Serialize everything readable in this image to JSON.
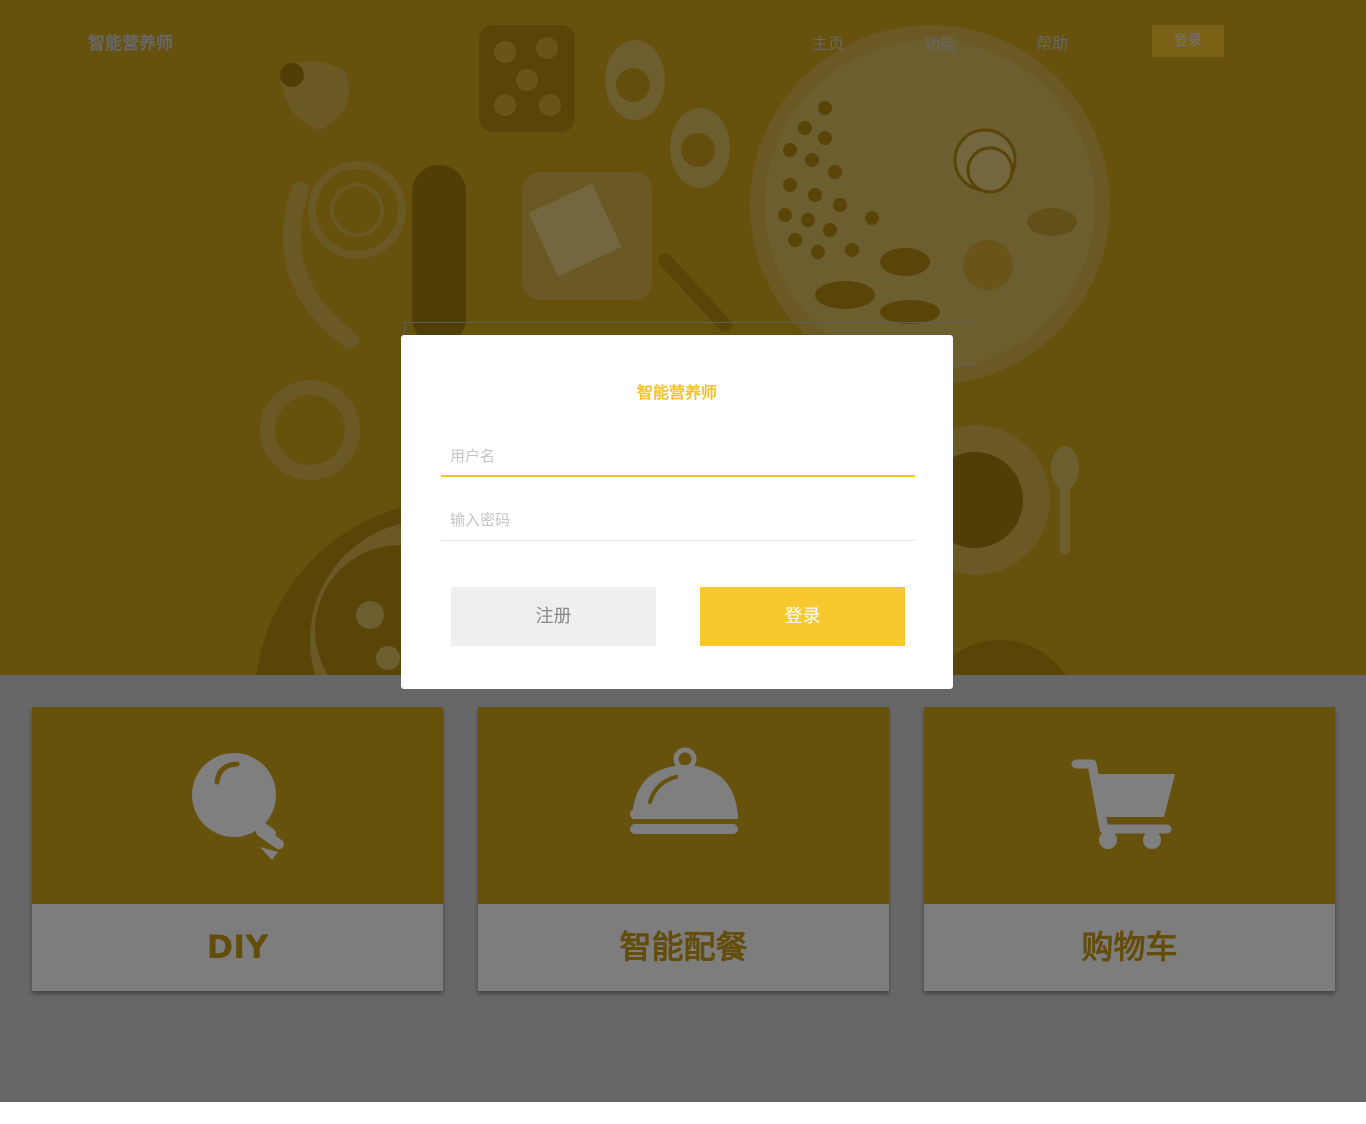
{
  "nav": {
    "logo": "智能营养师",
    "links": [
      "主页",
      "功能",
      "帮助"
    ],
    "login": "登录"
  },
  "colors": {
    "accent": "#f7c22a",
    "hero": "#cca21a",
    "panel": "#fafafa",
    "overlay": "rgba(0,0,0,0.5)"
  },
  "features": [
    {
      "label": "DIY",
      "icon": "lightbulb-icon"
    },
    {
      "label": "智能配餐",
      "icon": "food-cloche-icon"
    },
    {
      "label": "购物车",
      "icon": "shopping-cart-icon"
    }
  ],
  "login_modal": {
    "title": "智能营养师",
    "username_placeholder": "用户名",
    "password_placeholder": "输入密码",
    "register_label": "注册",
    "login_label": "登录"
  }
}
